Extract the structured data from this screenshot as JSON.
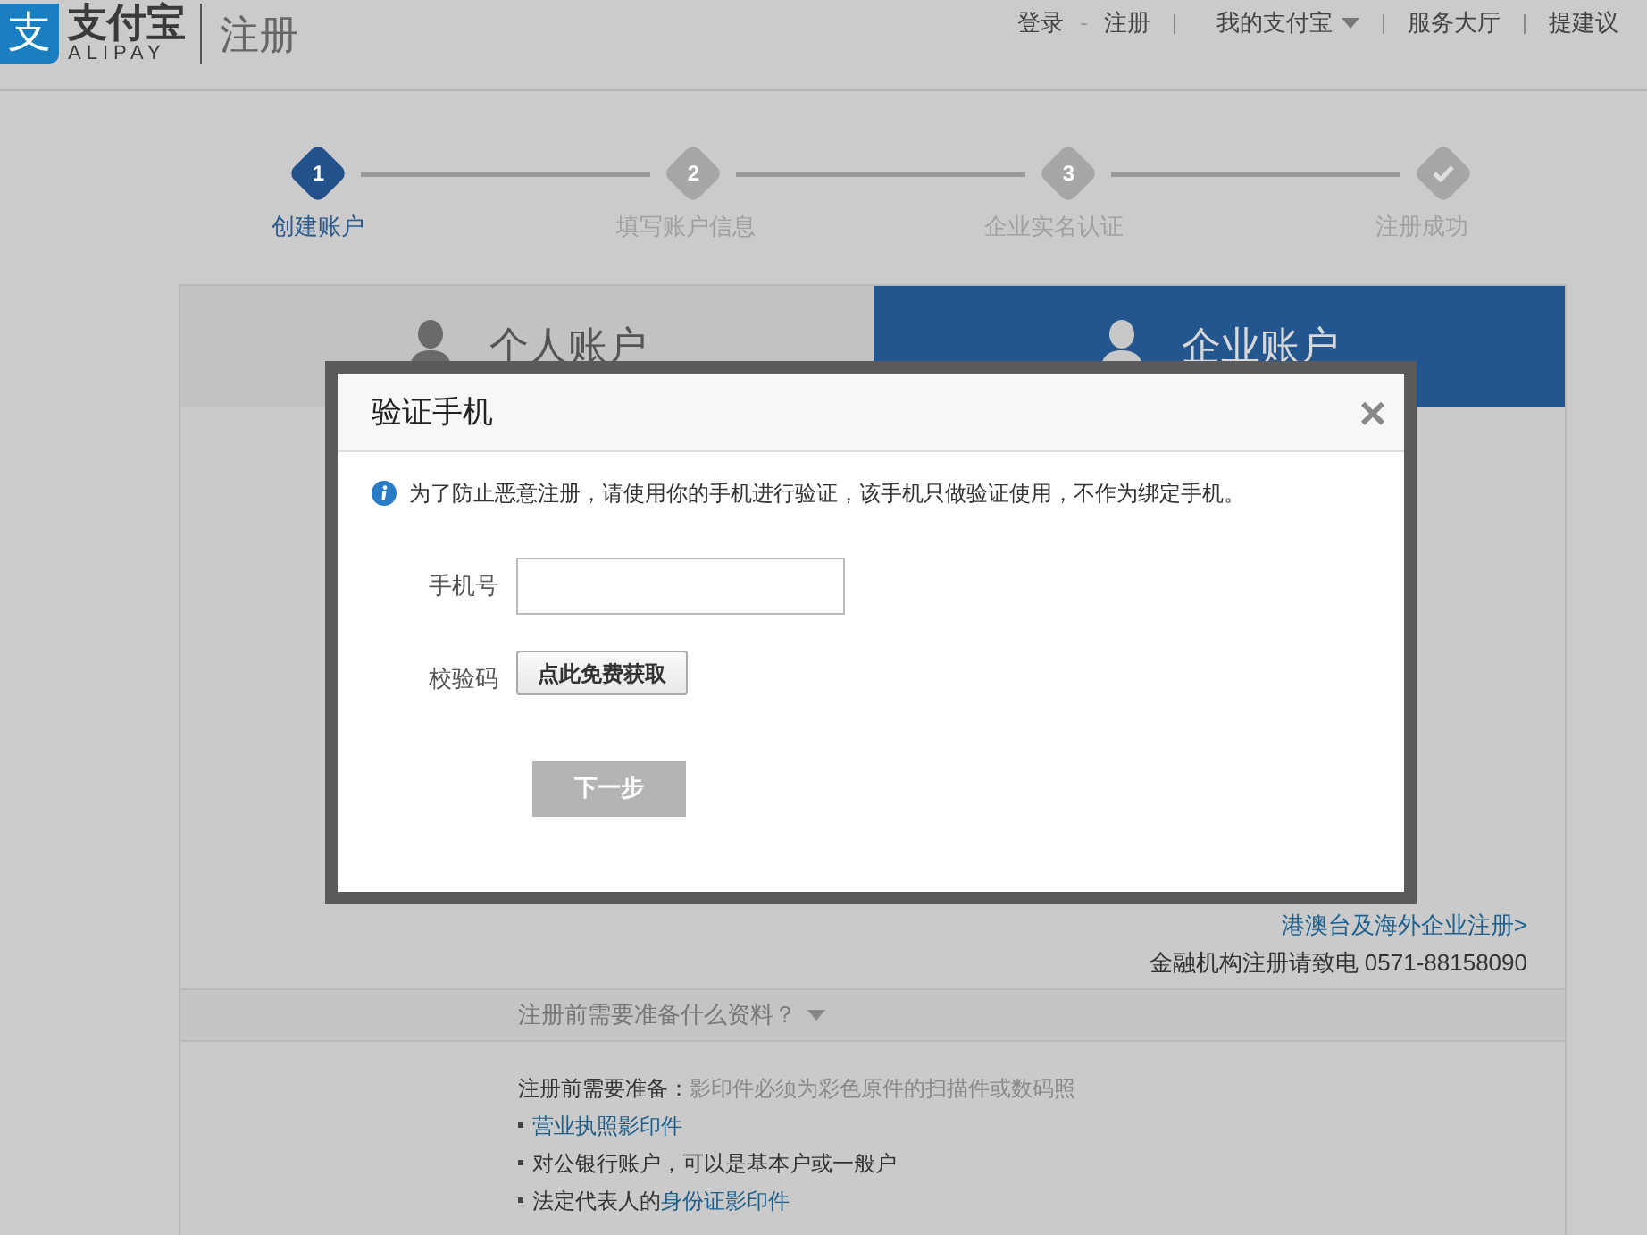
{
  "header": {
    "logo_mark": "支",
    "logo_name": "支付宝",
    "logo_sub": "ALIPAY",
    "page_title": "注册",
    "nav": {
      "login": "登录",
      "dash": "-",
      "register": "注册",
      "my_alipay": "我的支付宝",
      "service": "服务大厅",
      "feedback": "提建议"
    }
  },
  "steps": [
    {
      "kind": "number",
      "mark": "1",
      "label": "创建账户",
      "selected": true
    },
    {
      "kind": "number",
      "mark": "2",
      "label": "填写账户信息",
      "selected": false
    },
    {
      "kind": "number",
      "mark": "3",
      "label": "企业实名认证",
      "selected": false
    },
    {
      "kind": "check",
      "label": "注册成功",
      "selected": false
    }
  ],
  "tabs": [
    {
      "label": "个人账户",
      "selected": false
    },
    {
      "label": "企业账户",
      "selected": true
    }
  ],
  "overseas_link": "港澳台及海外企业注册>",
  "hotline": "金融机构注册请致电 0571-88158090",
  "faq_toggle": "注册前需要准备什么资料？",
  "requirements": {
    "title": "注册前需要准备：",
    "note": "影印件必须为彩色原件的扫描件或数码照",
    "items": [
      {
        "link": "营业执照影印件"
      },
      {
        "text": "对公银行账户，可以是基本户或一般户"
      },
      {
        "text": "法定代表人的",
        "link": "身份证影印件"
      }
    ]
  },
  "dialog": {
    "title": "验证手机",
    "close": "×",
    "notice": "为了防止恶意注册，请使用你的手机进行验证，该手机只做验证使用，不作为绑定手机。",
    "phone_label": "手机号",
    "code_label": "校验码",
    "code_button": "点此免费获取",
    "next_button": {
      "label": "下一步",
      "disabled": true
    }
  }
}
